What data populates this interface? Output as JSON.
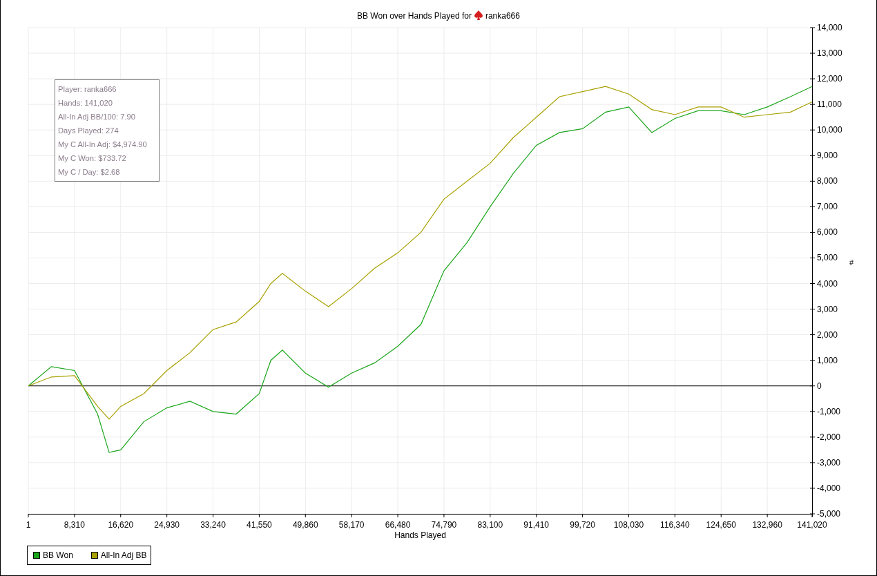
{
  "header": {
    "text": "BB Won over Hands Played for",
    "player": "ranka666"
  },
  "chart": {
    "chart_data": {
      "type": "line",
      "xlabel": "Hands Played",
      "ylabel": "#",
      "x": [
        1,
        4155,
        8310,
        12465,
        14540,
        16620,
        20775,
        24930,
        29085,
        33240,
        37395,
        41550,
        43630,
        45705,
        49860,
        54015,
        58170,
        62325,
        66480,
        70635,
        74790,
        78945,
        83100,
        87255,
        91410,
        95565,
        99720,
        103875,
        108030,
        112185,
        116340,
        120495,
        124650,
        128805,
        132960,
        137115,
        141020
      ],
      "series": [
        {
          "name": "BB Won",
          "color": "#1aa51a",
          "values": [
            0,
            750,
            600,
            -1100,
            -2600,
            -2500,
            -1400,
            -860,
            -600,
            -1000,
            -1100,
            -300,
            1000,
            1400,
            500,
            -50,
            500,
            900,
            1550,
            2400,
            4500,
            5600,
            7000,
            8300,
            9400,
            9900,
            10050,
            10700,
            10900,
            9900,
            10450,
            10750,
            10750,
            10600,
            10900,
            11300,
            11700
          ]
        },
        {
          "name": "All-In Adj BB",
          "color": "#a8a000",
          "values": [
            0,
            350,
            400,
            -800,
            -1300,
            -800,
            -300,
            600,
            1300,
            2200,
            2500,
            3300,
            4000,
            4400,
            3700,
            3100,
            3800,
            4600,
            5200,
            6000,
            7300,
            8000,
            8700,
            9700,
            10500,
            11300,
            11500,
            11700,
            11400,
            10800,
            10600,
            10900,
            10900,
            10500,
            10600,
            10700,
            11100
          ]
        }
      ],
      "grid": true,
      "xlim": [
        1,
        141020
      ],
      "ylim": [
        -5000,
        14000
      ],
      "xticks": [
        {
          "value": 1,
          "label": "1"
        },
        {
          "value": 8310,
          "label": "8,310"
        },
        {
          "value": 16620,
          "label": "16,620"
        },
        {
          "value": 24930,
          "label": "24,930"
        },
        {
          "value": 33240,
          "label": "33,240"
        },
        {
          "value": 41550,
          "label": "41,550"
        },
        {
          "value": 49860,
          "label": "49,860"
        },
        {
          "value": 58170,
          "label": "58,170"
        },
        {
          "value": 66480,
          "label": "66,480"
        },
        {
          "value": 74790,
          "label": "74,790"
        },
        {
          "value": 83100,
          "label": "83,100"
        },
        {
          "value": 91410,
          "label": "91,410"
        },
        {
          "value": 99720,
          "label": "99,720"
        },
        {
          "value": 108030,
          "label": "108,030"
        },
        {
          "value": 116340,
          "label": "116,340"
        },
        {
          "value": 124650,
          "label": "124,650"
        },
        {
          "value": 132960,
          "label": "132,960"
        },
        {
          "value": 141020,
          "label": "141,020"
        }
      ],
      "yticks": [
        {
          "value": 14000,
          "label": "14,000"
        },
        {
          "value": 13000,
          "label": "13,000"
        },
        {
          "value": 12000,
          "label": "12,000"
        },
        {
          "value": 11000,
          "label": "11,000"
        },
        {
          "value": 10000,
          "label": "10,000"
        },
        {
          "value": 9000,
          "label": "9,000"
        },
        {
          "value": 8000,
          "label": "8,000"
        },
        {
          "value": 7000,
          "label": "7,000"
        },
        {
          "value": 6000,
          "label": "6,000"
        },
        {
          "value": 5000,
          "label": "5,000"
        },
        {
          "value": 4000,
          "label": "4,000"
        },
        {
          "value": 3000,
          "label": "3,000"
        },
        {
          "value": 2000,
          "label": "2,000"
        },
        {
          "value": 1000,
          "label": "1,000"
        },
        {
          "value": 0,
          "label": "0"
        },
        {
          "value": -1000,
          "label": "-1,000"
        },
        {
          "value": -2000,
          "label": "-2,000"
        },
        {
          "value": -3000,
          "label": "-3,000"
        },
        {
          "value": -4000,
          "label": "-4,000"
        },
        {
          "value": -5000,
          "label": "-5,000"
        }
      ]
    },
    "stats": [
      "Player: ranka666",
      "Hands: 141,020",
      "All-In Adj BB/100: 7.90",
      "Days Played: 274",
      "My C All-In Adj: $4,974.90",
      "My C Won: $733.72",
      "My C / Day: $2.68"
    ]
  }
}
